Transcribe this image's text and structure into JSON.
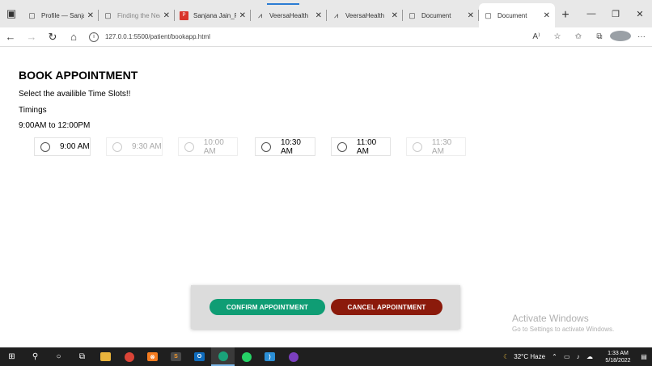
{
  "browser": {
    "tabs": [
      {
        "title": "Profile — Sanjana",
        "icon": "page-icon"
      },
      {
        "title": "Finding the Near",
        "icon": "page-icon"
      },
      {
        "title": "Sanjana Jain_Res",
        "icon": "pdf-icon"
      },
      {
        "title": "VeersaHealth",
        "icon": "logo-icon"
      },
      {
        "title": "VeersaHealth",
        "icon": "logo-icon"
      },
      {
        "title": "Document",
        "icon": "page-icon"
      },
      {
        "title": "Document",
        "icon": "page-icon"
      }
    ],
    "address": "127.0.0.1:5500/patient/bookapp.html"
  },
  "page": {
    "title": "BOOK APPOINTMENT",
    "instruction": "Select the availible Time Slots!!",
    "timings_label": "Timings",
    "timings_range": "9:00AM to 12:00PM",
    "slots": [
      {
        "label": "9:00 AM",
        "enabled": true
      },
      {
        "label": "9:30 AM",
        "enabled": false
      },
      {
        "label": "10:00 AM",
        "enabled": false
      },
      {
        "label": "10:30 AM",
        "enabled": true
      },
      {
        "label": "11:00 AM",
        "enabled": true
      },
      {
        "label": "11:30 AM",
        "enabled": false
      }
    ],
    "confirm_label": "CONFIRM APPOINTMENT",
    "cancel_label": "CANCEL APPOINTMENT",
    "colors": {
      "confirm": "#0f9d74",
      "cancel": "#8b1a0b"
    }
  },
  "watermark": {
    "line1": "Activate Windows",
    "line2": "Go to Settings to activate Windows."
  },
  "taskbar": {
    "weather": "32°C  Haze",
    "time": "1:33 AM",
    "date": "5/18/2022"
  }
}
